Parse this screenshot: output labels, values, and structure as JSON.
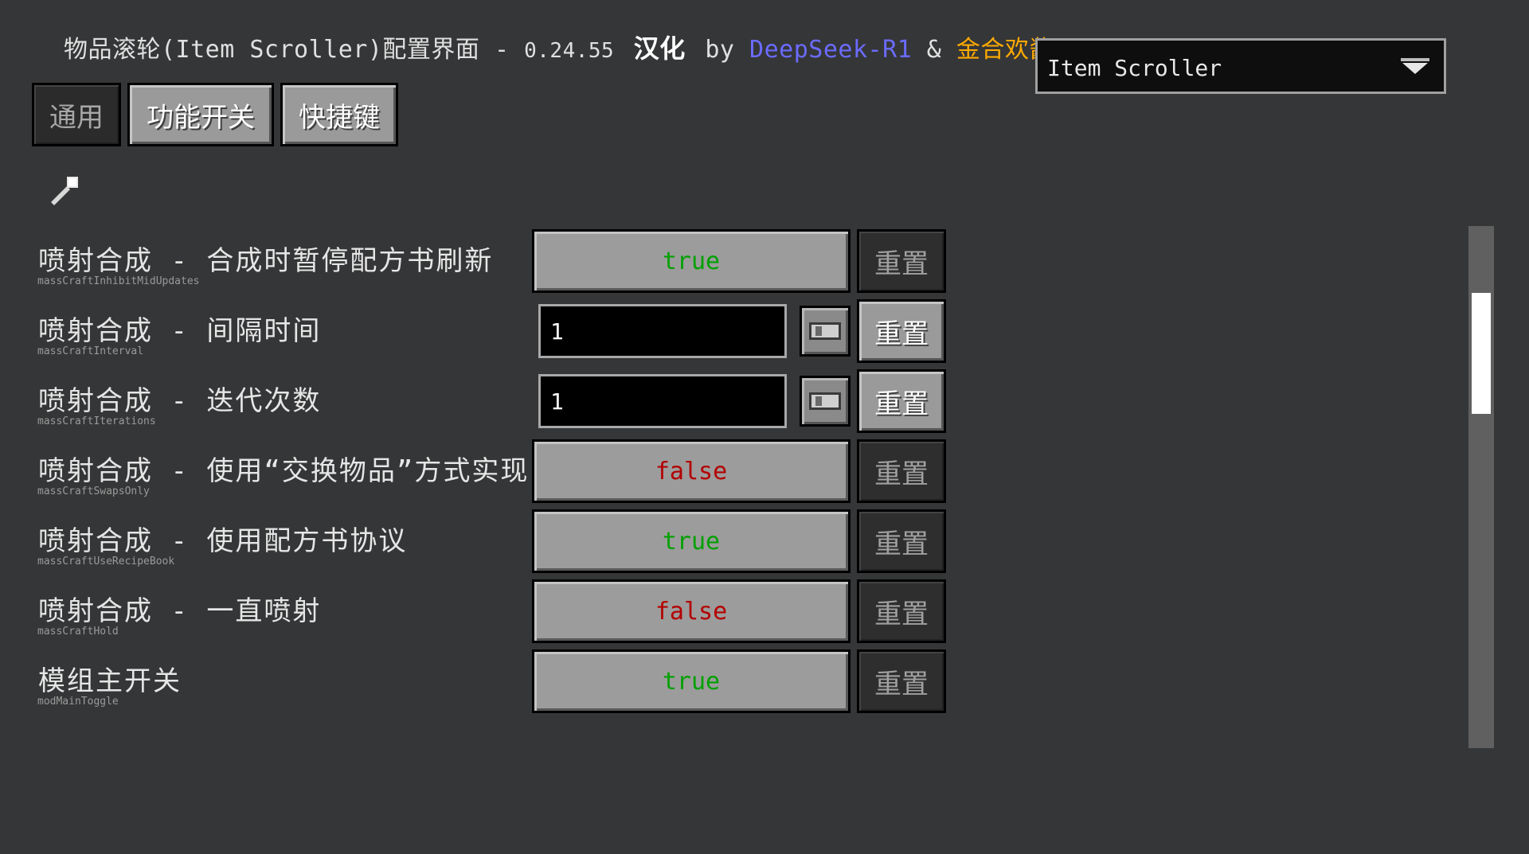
{
  "header": {
    "title_prefix": "物品滚轮(Item Scroller)配置界面 - ",
    "version": "0.24.55",
    "localized": "汉化",
    "by": "by",
    "ai": "DeepSeek-R1",
    "amp": "&",
    "author": "金合欢酱(acac"
  },
  "mod_selector": {
    "selected": "Item Scroller",
    "icon": "chevron-down-icon"
  },
  "tabs": [
    {
      "label": "通用",
      "active": true
    },
    {
      "label": "功能开关",
      "active": false
    },
    {
      "label": "快捷键",
      "active": false
    }
  ],
  "search": {
    "icon": "search-icon"
  },
  "reset_label": "重置",
  "options": [
    {
      "label": "喷射合成 - 合成时暂停配方书刷新",
      "key": "massCraftInhibitMidUpdates",
      "type": "bool",
      "value": "true",
      "reset_enabled": false
    },
    {
      "label": "喷射合成 - 间隔时间",
      "key": "massCraftInterval",
      "type": "int",
      "value": "1",
      "reset_enabled": true
    },
    {
      "label": "喷射合成 - 迭代次数",
      "key": "massCraftIterations",
      "type": "int",
      "value": "1",
      "reset_enabled": true
    },
    {
      "label": "喷射合成 - 使用“交换物品”方式实现",
      "key": "massCraftSwapsOnly",
      "type": "bool",
      "value": "false",
      "reset_enabled": false
    },
    {
      "label": "喷射合成 - 使用配方书协议",
      "key": "massCraftUseRecipeBook",
      "type": "bool",
      "value": "true",
      "reset_enabled": false
    },
    {
      "label": "喷射合成 - 一直喷射",
      "key": "massCraftHold",
      "type": "bool",
      "value": "false",
      "reset_enabled": false
    },
    {
      "label": "模组主开关",
      "key": "modMainToggle",
      "type": "bool",
      "value": "true",
      "reset_enabled": false
    }
  ],
  "colors": {
    "background": "#353637",
    "true_text": "#00a000",
    "false_text": "#b30000",
    "ai_name": "#6b6bff",
    "author_name": "#ffaa00"
  }
}
